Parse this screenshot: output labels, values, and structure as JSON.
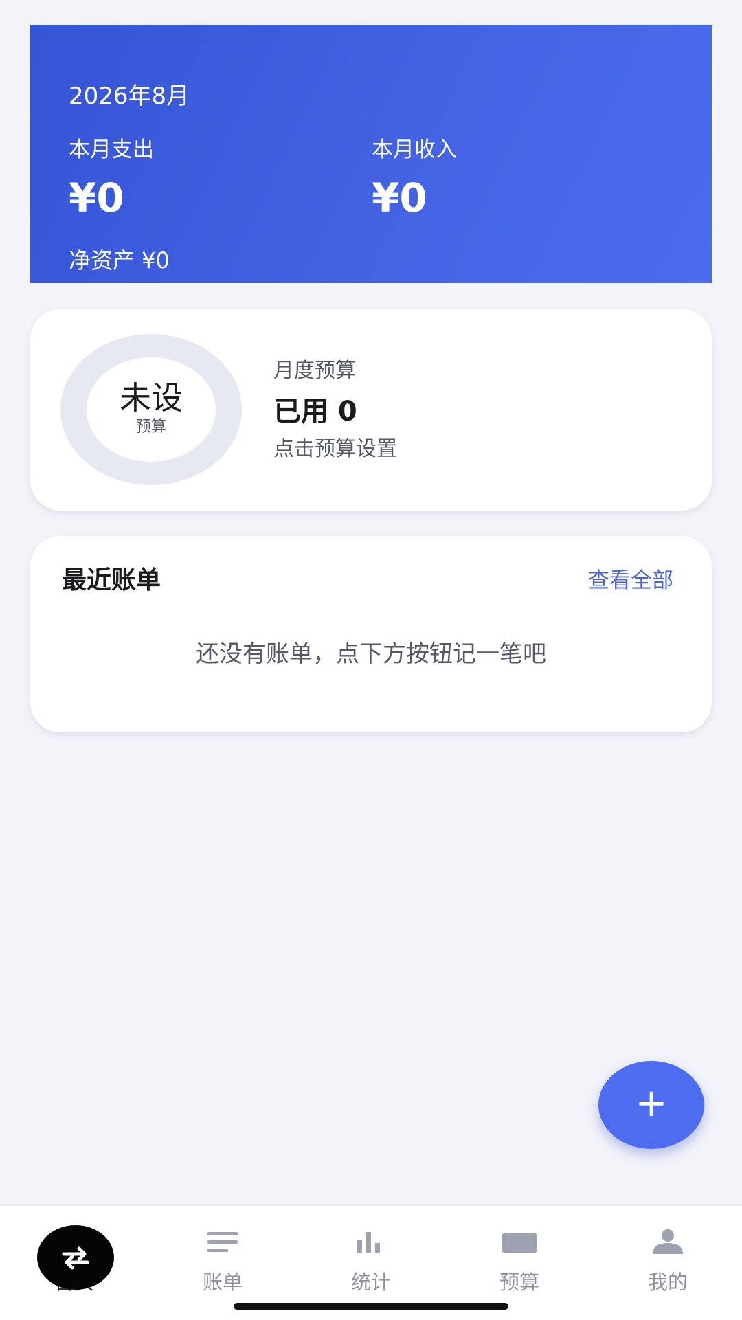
{
  "summary": {
    "month": "2026年8月",
    "expense_label": "本月支出",
    "expense_value": "¥0",
    "income_label": "本月收入",
    "income_value": "¥0",
    "net_assets": "净资产 ¥0"
  },
  "budget": {
    "ring_main": "未设",
    "ring_sub": "预算",
    "title": "月度预算",
    "used": "已用 0",
    "hint": "点击预算设置"
  },
  "recent": {
    "title": "最近账单",
    "view_all": "查看全部",
    "empty_text": "还没有账单，点下方按钮记一笔吧"
  },
  "fab": {
    "label": "+"
  },
  "tabs": [
    {
      "label": "首页",
      "icon": "home-icon"
    },
    {
      "label": "账单",
      "icon": "list-icon"
    },
    {
      "label": "统计",
      "icon": "bar-chart-icon"
    },
    {
      "label": "预算",
      "icon": "wallet-icon"
    },
    {
      "label": "我的",
      "icon": "person-icon"
    }
  ],
  "colors": {
    "accent": "#4e6cf0",
    "header_gradient_start": "#3554d6",
    "header_gradient_end": "#4c6cf0",
    "link": "#4a63cf",
    "background": "#f3f4fa"
  }
}
